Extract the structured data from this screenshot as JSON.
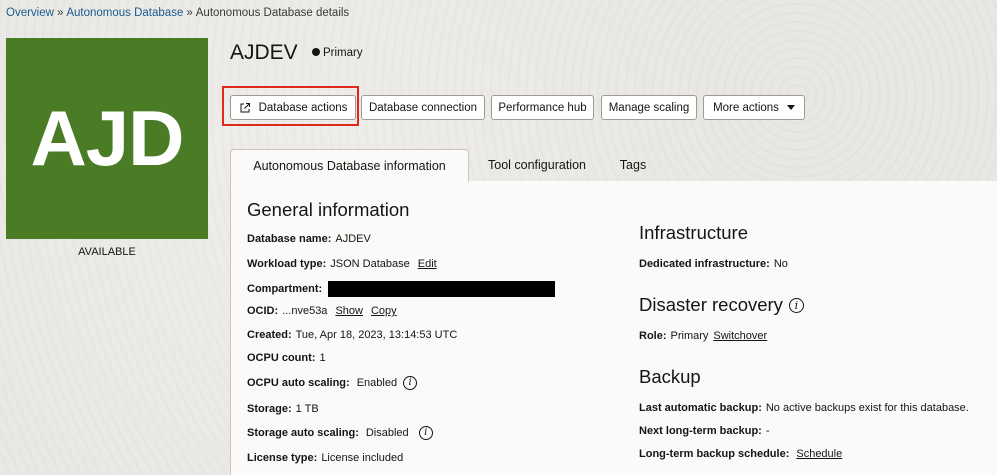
{
  "breadcrumb": {
    "items": [
      "Overview",
      "Autonomous Database"
    ],
    "separator": "»",
    "current": "Autonomous Database details"
  },
  "tile": {
    "initials": "AJD",
    "color": "#4a7c26",
    "status": "AVAILABLE"
  },
  "header": {
    "title": "AJDEV",
    "role": "Primary"
  },
  "actions": {
    "database_actions": "Database actions",
    "database_connection": "Database connection",
    "performance_hub": "Performance hub",
    "manage_scaling": "Manage scaling",
    "more_actions": "More actions"
  },
  "tabs": {
    "info": "Autonomous Database information",
    "tool_config": "Tool configuration",
    "tags": "Tags"
  },
  "general": {
    "heading": "General information",
    "database_name_label": "Database name:",
    "database_name": "AJDEV",
    "workload_type_label": "Workload type:",
    "workload_type": "JSON Database",
    "edit_link": "Edit",
    "compartment_label": "Compartment:",
    "ocid_label": "OCID:",
    "ocid": "...nve53a",
    "show_link": "Show",
    "copy_link": "Copy",
    "created_label": "Created:",
    "created": "Tue, Apr 18, 2023, 13:14:53 UTC",
    "ocpu_count_label": "OCPU count:",
    "ocpu_count": "1",
    "ocpu_auto_scaling_label": "OCPU auto scaling:",
    "ocpu_auto_scaling": "Enabled",
    "storage_label": "Storage:",
    "storage": "1 TB",
    "storage_auto_scaling_label": "Storage auto scaling:",
    "storage_auto_scaling": "Disabled",
    "license_type_label": "License type:",
    "license_type": "License included"
  },
  "infrastructure": {
    "heading": "Infrastructure",
    "dedicated_label": "Dedicated infrastructure:",
    "dedicated": "No"
  },
  "disaster_recovery": {
    "heading": "Disaster recovery",
    "role_label": "Role:",
    "role": "Primary",
    "switchover_link": "Switchover"
  },
  "backup": {
    "heading": "Backup",
    "last_auto_label": "Last automatic backup:",
    "last_auto": "No active backups exist for this database.",
    "next_long_term_label": "Next long-term backup:",
    "next_long_term": "-",
    "schedule_label": "Long-term backup schedule:",
    "schedule_link": "Schedule"
  },
  "icons": {
    "external": "external-link-icon",
    "caret": "chevron-down-icon",
    "info": "info-icon"
  },
  "colors": {
    "highlight": "#e0281e",
    "link": "#1a5d8f"
  }
}
